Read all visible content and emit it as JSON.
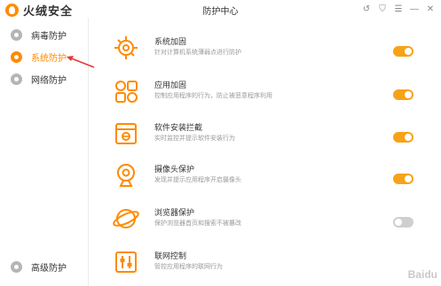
{
  "app": {
    "brand_name": "火绒安全",
    "window_title": "防护中心",
    "accent_color": "#ff8a00",
    "toggle_on_color": "#f7a318"
  },
  "window_controls": [
    {
      "name": "back-icon",
      "glyph": "↺"
    },
    {
      "name": "skin-icon",
      "glyph": "⛉"
    },
    {
      "name": "menu-icon",
      "glyph": "☰"
    },
    {
      "name": "minimize-icon",
      "glyph": "—"
    },
    {
      "name": "close-icon",
      "glyph": "✕"
    }
  ],
  "sidebar": {
    "items": [
      {
        "label": "病毒防护",
        "active": false
      },
      {
        "label": "系统防护",
        "active": true
      },
      {
        "label": "网络防护",
        "active": false
      }
    ],
    "footer_label": "高级防护"
  },
  "features": [
    {
      "title": "系统加固",
      "desc": "针对计算机系统薄弱点进行防护",
      "enabled": true,
      "icon": "gear-shield-icon"
    },
    {
      "title": "应用加固",
      "desc": "控制应用程序的行为，防止被恶意程序利用",
      "enabled": true,
      "icon": "app-grid-icon"
    },
    {
      "title": "软件安装拦截",
      "desc": "实时监控并提示软件安装行为",
      "enabled": true,
      "icon": "install-box-icon"
    },
    {
      "title": "摄像头保护",
      "desc": "发现并提示应用程序开启摄像头",
      "enabled": true,
      "icon": "webcam-icon"
    },
    {
      "title": "浏览器保护",
      "desc": "保护浏览器首页和搜索不被篡改",
      "enabled": false,
      "icon": "browser-icon"
    },
    {
      "title": "联网控制",
      "desc": "管控应用程序的联网行为",
      "enabled": false,
      "icon": "network-control-icon"
    }
  ],
  "watermark": "Baidu"
}
